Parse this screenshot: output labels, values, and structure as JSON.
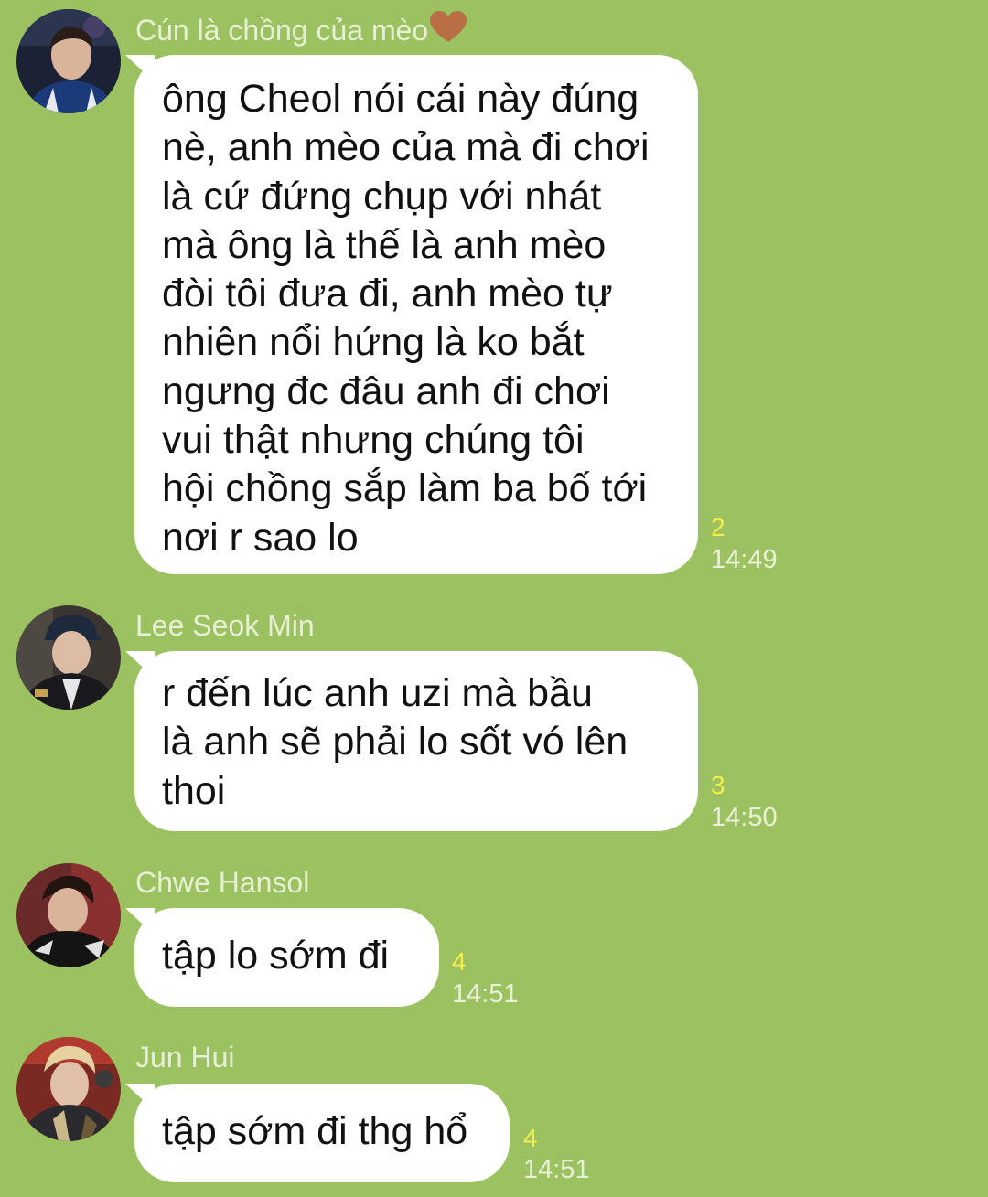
{
  "messages": [
    {
      "sender": "Cún là chồng của mèo",
      "sender_emoji": "brown-heart-icon",
      "text": "ông Cheol nói cái này đúng\nnè, anh mèo của mà đi chơi\nlà cứ đứng chụp với nhát\nmà ông là thế là anh mèo\nđòi tôi đưa đi, anh mèo tự\nnhiên nổi hứng là ko bắt\nngưng đc đâu anh đi chơi\nvui thật nhưng chúng tôi\nhội chồng sắp làm ba bố tới\nnơi r sao lo",
      "read_count": "2",
      "time": "14:49"
    },
    {
      "sender": "Lee Seok Min",
      "text": "r đến lúc anh uzi mà bầu\nlà anh sẽ phải lo sốt vó lên\nthoi",
      "read_count": "3",
      "time": "14:50"
    },
    {
      "sender": "Chwe Hansol",
      "text": "tập lo sớm đi",
      "read_count": "4",
      "time": "14:51"
    },
    {
      "sender": "Jun Hui",
      "text": "tập sớm đi thg hổ",
      "read_count": "4",
      "time": "14:51"
    }
  ],
  "colors": {
    "background": "#9cc160",
    "bubble": "#ffffff",
    "read_count": "#f6ee4a",
    "meta_text": "#e8f0d8"
  }
}
